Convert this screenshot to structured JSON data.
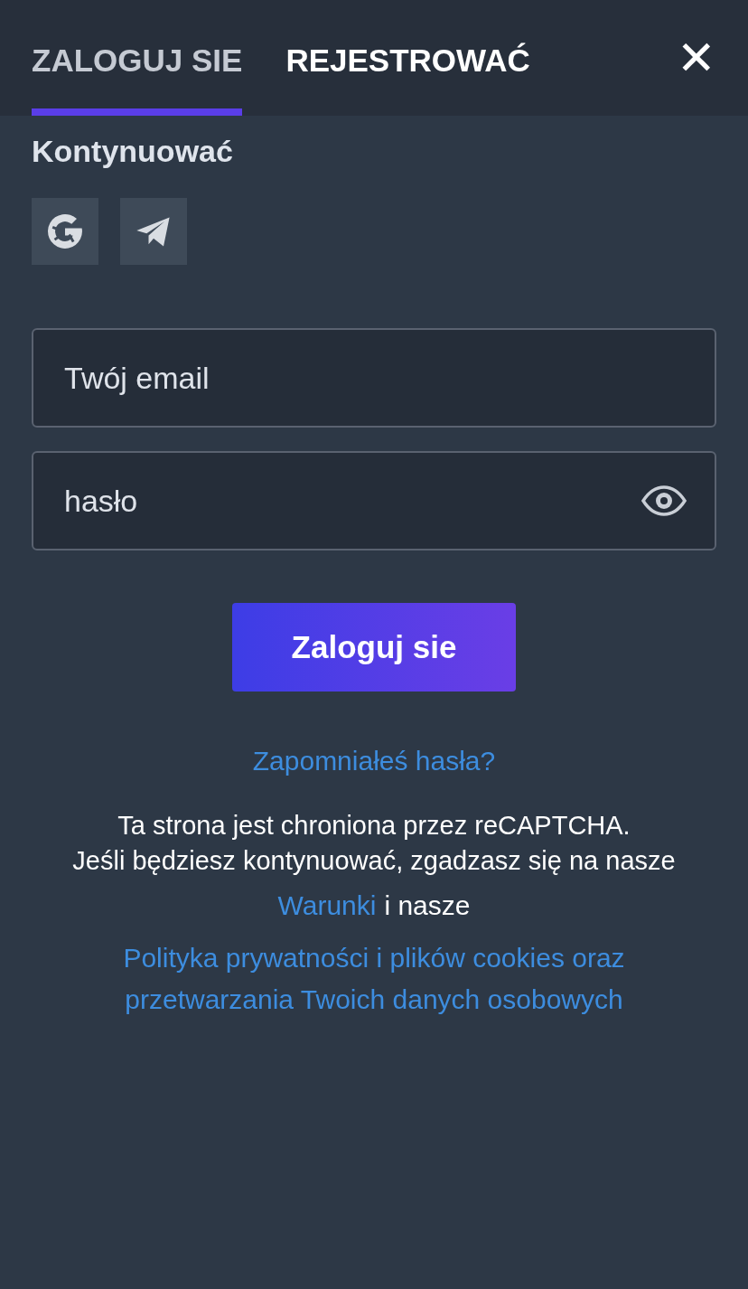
{
  "tabs": [
    {
      "label": "ZALOGUJ SIE",
      "selected": true
    },
    {
      "label": "REJESTROWAĆ",
      "selected": false
    }
  ],
  "close": {
    "label": "✕"
  },
  "continue_heading": "Kontynuować",
  "social_buttons": [
    {
      "kind": "google"
    },
    {
      "kind": "telegram"
    }
  ],
  "email": {
    "placeholder": "Twój email"
  },
  "password": {
    "placeholder": "hasło"
  },
  "submit": "Zaloguj sie",
  "forgot_link": "Zapomniałeś hasła?",
  "notice_lines": [
    "Ta strona jest chroniona przez reCAPTCHA.",
    "Jeśli będziesz kontynuować, zgadzasz się na nasze"
  ],
  "terms_link": "Warunki",
  "terms_suffix": "i nasze",
  "privacy_link": "Polityka prywatności i plików cookies oraz przetwarzania Twoich danych osobowych"
}
